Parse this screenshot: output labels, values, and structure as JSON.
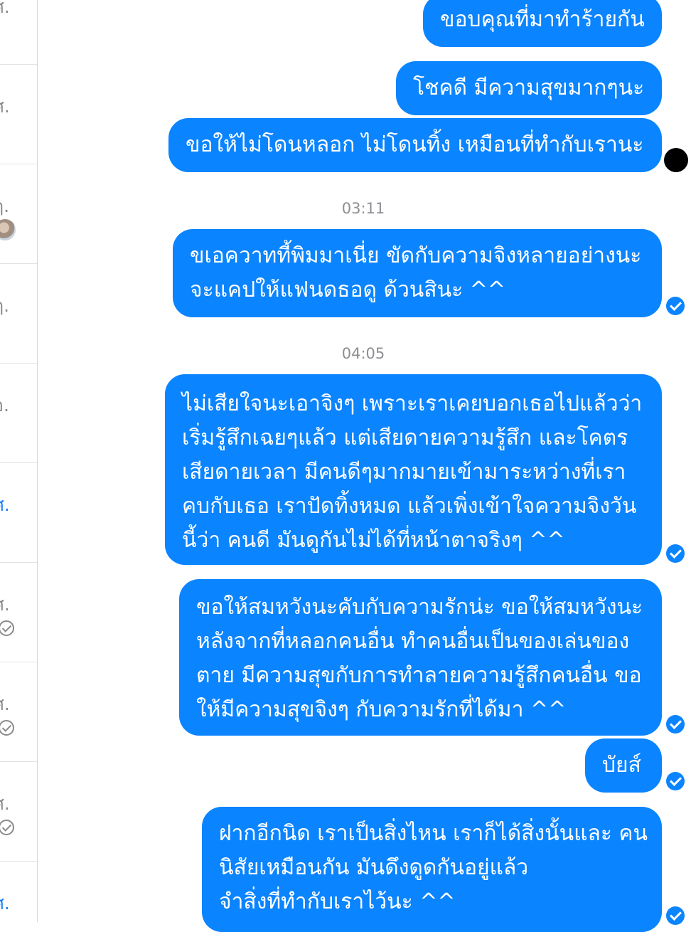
{
  "sidebar": {
    "rows": [
      {
        "label": "ศ.",
        "style": "gray",
        "status": "none"
      },
      {
        "label": "ศ.",
        "style": "gray",
        "status": "none"
      },
      {
        "label": "ฤ.",
        "style": "gray",
        "status": "avatar"
      },
      {
        "label": "ฤ.",
        "style": "gray",
        "status": "none"
      },
      {
        "label": "อ.",
        "style": "gray",
        "status": "none"
      },
      {
        "label": "ศ.",
        "style": "blue",
        "status": "none"
      },
      {
        "label": "ศ.",
        "style": "gray",
        "status": "check"
      },
      {
        "label": "ศ.",
        "style": "gray",
        "status": "check"
      },
      {
        "label": "ศ.",
        "style": "gray",
        "status": "check"
      },
      {
        "label": "ศ.",
        "style": "blue",
        "status": "none"
      }
    ]
  },
  "chat": {
    "messages": [
      {
        "lines": [
          "ขอบคุณที่มาทำร้ายกัน"
        ]
      },
      {
        "lines": [
          "โชคดี มีความสุขมากๆนะ"
        ]
      },
      {
        "lines": [
          "ขอให้ไม่โดนหลอก ไม่โดนทิ้ง เหมือนที่ทำกับเรานะ"
        ]
      },
      {
        "lines": [
          "ขเอควาทที้พิมมาเนี่ย ขัดกับความจิงหลายอย่างนะ",
          "จะแคปให้แฟนดธอดู ด้วนสินะ ^^"
        ]
      },
      {
        "lines": [
          "ไม่เสียใจนะเอาจิงๆ เพราะเราเคยบอกเธอไปแล้วว่า",
          "เริ่มรู้สึกเฉยๆแล้ว แต่เสียดายความรู้สึก และโคตร",
          "เสียดายเวลา มีคนดีๆมากมายเข้ามาระหว่างที่เรา",
          "คบกับเธอ เราปัดทิ้งหมด แล้วเพิ่งเข้าใจความจิงวัน",
          "นี้ว่า คนดี มันดูกันไม่ได้ที่หน้าตาจริงๆ ^^"
        ]
      },
      {
        "lines": [
          "ขอให้สมหวังนะคับกับความรักน่ะ ขอให้สมหวังนะ",
          "หลังจากที่หลอกคนอื่น ทำคนอื่นเป็นของเล่นของ",
          "ตาย มีความสุขกับการทำลายความรู้สึกคนอื่น ขอ",
          "ให้มีความสุขจิงๆ กับความรักที่ได้มา ^^"
        ]
      },
      {
        "lines": [
          "บัยส์"
        ]
      },
      {
        "lines": [
          "ฝากอีกนิด เราเป็นสิ่งไหน เราก็ได้สิ่งนั้นและ คน",
          "นิสัยเหมือนกัน มันดึงดูดกันอยู่แล้ว",
          "จำสิ่งที่ทำกับเราไว้นะ ^^"
        ]
      }
    ],
    "timestamps": [
      "03:11",
      "04:05"
    ],
    "colors": {
      "bubble": "#0a84ff",
      "timestamp": "#8e8e93",
      "text_on_bubble": "#ffffff"
    }
  }
}
